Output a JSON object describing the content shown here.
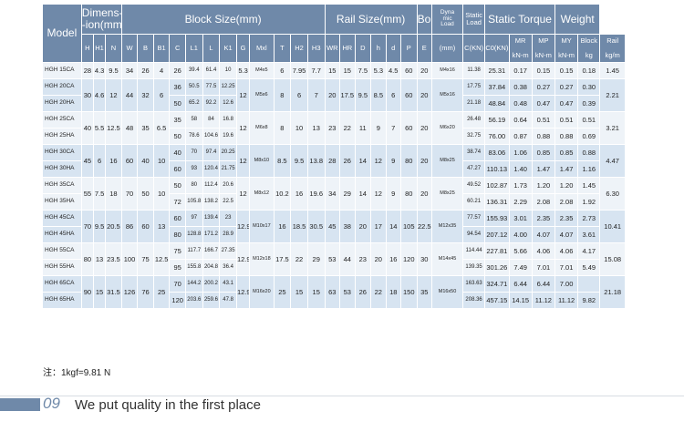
{
  "table": {
    "header": {
      "model": "Model",
      "dimension": [
        "Dimens-",
        "-ion(mm)"
      ],
      "block_size": "Block Size(mm)",
      "rail_size": "Rail Size(mm)",
      "bolt": "Bolt",
      "dyn_load": [
        "Dyna",
        "mic",
        "Load"
      ],
      "static_load": [
        "Static",
        "Load"
      ],
      "static_torque": "Static Torque",
      "weight": "Weight",
      "cols": [
        "H",
        "H1",
        "N",
        "W",
        "B",
        "B1",
        "C",
        "L1",
        "L",
        "K1",
        "G",
        "Mxl",
        "T",
        "H2",
        "H3",
        "WR",
        "HR",
        "D",
        "h",
        "d",
        "P",
        "E",
        "(mm)",
        "C(KN)",
        "C0(KN)",
        "MR",
        "MP",
        "MY",
        "Block",
        "Rail"
      ],
      "units": [
        "kN-m",
        "kN-m",
        "kN-m",
        "kg",
        "kg/m"
      ]
    },
    "rows": [
      [
        "HGH 15CA",
        "28",
        "4.3",
        "9.5",
        "34",
        "26",
        "4",
        "26",
        "39.4",
        "61.4",
        "10",
        "5.3",
        "M4x5",
        "6",
        "7.95",
        "7.7",
        "15",
        "15",
        "7.5",
        "5.3",
        "4.5",
        "60",
        "20",
        "M4x16",
        "11.38",
        "25.31",
        "0.17",
        "0.15",
        "0.15",
        "0.18",
        "1.45"
      ],
      [
        "HGH 20CA",
        "30",
        "4.6",
        "12",
        "44",
        "32",
        "6",
        "36",
        "50.5",
        "77.5",
        "12.25",
        "12",
        "M5x6",
        "8",
        "6",
        "7",
        "20",
        "17.5",
        "9.5",
        "8.5",
        "6",
        "60",
        "20",
        "M5x16",
        "17.75",
        "37.84",
        "0.38",
        "0.27",
        "0.27",
        "0.30",
        "2.21"
      ],
      [
        "HGH 20HA",
        "",
        "",
        "",
        "",
        "",
        "",
        "50",
        "65.2",
        "92.2",
        "12.6",
        "",
        "",
        "",
        "",
        "",
        "",
        "",
        "",
        "",
        "",
        "",
        "",
        "",
        "21.18",
        "48.84",
        "0.48",
        "0.47",
        "0.47",
        "0.39",
        ""
      ],
      [
        "HGH 25CA",
        "40",
        "5.5",
        "12.5",
        "48",
        "35",
        "6.5",
        "35",
        "58",
        "84",
        "16.8",
        "12",
        "M6x8",
        "8",
        "10",
        "13",
        "23",
        "22",
        "11",
        "9",
        "7",
        "60",
        "20",
        "M6x20",
        "26.48",
        "56.19",
        "0.64",
        "0.51",
        "0.51",
        "0.51",
        "3.21"
      ],
      [
        "HGH 25HA",
        "",
        "",
        "",
        "",
        "",
        "",
        "50",
        "78.6",
        "104.6",
        "19.6",
        "",
        "",
        "",
        "",
        "",
        "",
        "",
        "",
        "",
        "",
        "",
        "",
        "",
        "32.75",
        "76.00",
        "0.87",
        "0.88",
        "0.88",
        "0.69",
        ""
      ],
      [
        "HGH 30CA",
        "45",
        "6",
        "16",
        "60",
        "40",
        "10",
        "40",
        "70",
        "97.4",
        "20.25",
        "12",
        "M8x10",
        "8.5",
        "9.5",
        "13.8",
        "28",
        "26",
        "14",
        "12",
        "9",
        "80",
        "20",
        "M8x25",
        "38.74",
        "83.06",
        "1.06",
        "0.85",
        "0.85",
        "0.88",
        "4.47"
      ],
      [
        "HGH 30HA",
        "",
        "",
        "",
        "",
        "",
        "",
        "60",
        "93",
        "120.4",
        "21.75",
        "",
        "",
        "",
        "",
        "",
        "",
        "",
        "",
        "",
        "",
        "",
        "",
        "",
        "47.27",
        "110.13",
        "1.40",
        "1.47",
        "1.47",
        "1.16",
        ""
      ],
      [
        "HGH 35CA",
        "55",
        "7.5",
        "18",
        "70",
        "50",
        "10",
        "50",
        "80",
        "112.4",
        "20.6",
        "12",
        "M8x12",
        "10.2",
        "16",
        "19.6",
        "34",
        "29",
        "14",
        "12",
        "9",
        "80",
        "20",
        "M8x25",
        "49.52",
        "102.87",
        "1.73",
        "1.20",
        "1.20",
        "1.45",
        "6.30"
      ],
      [
        "HGH 35HA",
        "",
        "",
        "",
        "",
        "",
        "",
        "72",
        "105.8",
        "138.2",
        "22.5",
        "",
        "",
        "",
        "",
        "",
        "",
        "",
        "",
        "",
        "",
        "",
        "",
        "",
        "60.21",
        "136.31",
        "2.29",
        "2.08",
        "2.08",
        "1.92",
        ""
      ],
      [
        "HGH 45CA",
        "70",
        "9.5",
        "20.5",
        "86",
        "60",
        "13",
        "60",
        "97",
        "139.4",
        "23",
        "12.9",
        "M10x17",
        "16",
        "18.5",
        "30.5",
        "45",
        "38",
        "20",
        "17",
        "14",
        "105",
        "22.5",
        "M12x35",
        "77.57",
        "155.93",
        "3.01",
        "2.35",
        "2.35",
        "2.73",
        "10.41"
      ],
      [
        "HGH 45HA",
        "",
        "",
        "",
        "",
        "",
        "",
        "80",
        "128.8",
        "171.2",
        "28.9",
        "",
        "",
        "",
        "",
        "",
        "",
        "",
        "",
        "",
        "",
        "",
        "",
        "",
        "94.54",
        "207.12",
        "4.00",
        "4.07",
        "4.07",
        "3.61",
        ""
      ],
      [
        "HGH 55CA",
        "80",
        "13",
        "23.5",
        "100",
        "75",
        "12.5",
        "75",
        "117.7",
        "166.7",
        "27.35",
        "12.9",
        "M12x18",
        "17.5",
        "22",
        "29",
        "53",
        "44",
        "23",
        "20",
        "16",
        "120",
        "30",
        "M14x45",
        "114.44",
        "227.81",
        "5.66",
        "4.06",
        "4.06",
        "4.17",
        "15.08"
      ],
      [
        "HGH 55HA",
        "",
        "",
        "",
        "",
        "",
        "",
        "95",
        "155.8",
        "204.8",
        "36.4",
        "",
        "",
        "",
        "",
        "",
        "",
        "",
        "",
        "",
        "",
        "",
        "",
        "",
        "139.35",
        "301.26",
        "7.49",
        "7.01",
        "7.01",
        "5.49",
        ""
      ],
      [
        "HGH 65CA",
        "90",
        "15",
        "31.5",
        "126",
        "76",
        "25",
        "70",
        "144.2",
        "200.2",
        "43.1",
        "12.9",
        "M16x20",
        "25",
        "15",
        "15",
        "63",
        "53",
        "26",
        "22",
        "18",
        "150",
        "35",
        "M16x50",
        "163.63",
        "324.71",
        "6.44",
        "6.44",
        "7.00",
        "",
        "21.18"
      ],
      [
        "HGH 65HA",
        "",
        "",
        "",
        "",
        "",
        "",
        "120",
        "203.6",
        "259.6",
        "47.8",
        "",
        "",
        "",
        "",
        "",
        "",
        "",
        "",
        "",
        "",
        "",
        "",
        "",
        "208.36",
        "457.15",
        "14.15",
        "11.12",
        "11.12",
        "9.82",
        ""
      ]
    ]
  },
  "note": "注：1kgf=9.81 N",
  "section": {
    "number": "09",
    "title": "We put quality in the first place"
  },
  "colors": {
    "header": "#6f89a9",
    "row_light": "#eef3f8",
    "row_dark": "#d7e4f1"
  }
}
